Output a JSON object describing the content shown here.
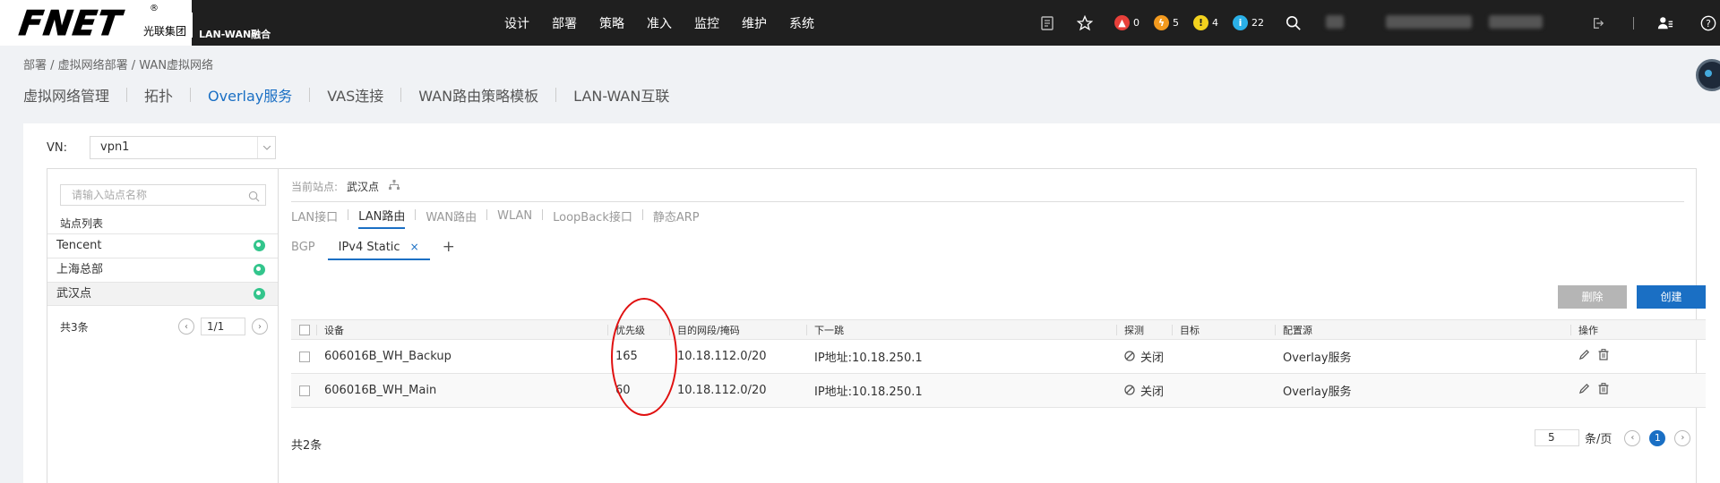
{
  "header": {
    "logo_text": "FNET",
    "logo_registered": "®",
    "logo_company": "光联集团",
    "logo_product": "LAN-WAN融合",
    "nav": [
      "设计",
      "部署",
      "策略",
      "准入",
      "监控",
      "维护",
      "系统"
    ],
    "alerts": [
      {
        "name": "critical",
        "count": "0",
        "color": "#e8403a",
        "glyph": "🔥"
      },
      {
        "name": "major",
        "count": "5",
        "color": "#f39a1e",
        "glyph": "⚡"
      },
      {
        "name": "minor",
        "count": "4",
        "color": "#f3d21e",
        "glyph": "!"
      },
      {
        "name": "info",
        "count": "22",
        "color": "#2ab0e8",
        "glyph": "i"
      }
    ]
  },
  "breadcrumb": "部署 / 虚拟网络部署 / WAN虚拟网络",
  "page_tabs": [
    "虚拟网络管理",
    "拓扑",
    "Overlay服务",
    "VAS连接",
    "WAN路由策略模板",
    "LAN-WAN互联"
  ],
  "vn": {
    "label": "VN:",
    "value": "vpn1"
  },
  "site_panel": {
    "search_placeholder": "请输入站点名称",
    "title": "站点列表",
    "sites": [
      "Tencent",
      "上海总部",
      "武汉点"
    ],
    "total": "共3条",
    "page": "1/1"
  },
  "current_site": {
    "label": "当前站点:",
    "value": "武汉点"
  },
  "sub_tabs": [
    "LAN接口",
    "LAN路由",
    "WAN路由",
    "WLAN",
    "LoopBack接口",
    "静态ARP"
  ],
  "proto_tabs": {
    "inactive": "BGP",
    "active": "IPv4 Static",
    "close": "×",
    "add": "+"
  },
  "buttons": {
    "delete": "删除",
    "create": "创建"
  },
  "table": {
    "headers": [
      "设备",
      "优先级",
      "目的网段/掩码",
      "下一跳",
      "探测",
      "目标",
      "配置源",
      "操作"
    ],
    "rows": [
      {
        "device": "606016B_WH_Backup",
        "priority": "165",
        "dest": "10.18.112.0/20",
        "nexthop": "IP地址:10.18.250.1",
        "probe": "关闭",
        "target": "",
        "source": "Overlay服务"
      },
      {
        "device": "606016B_WH_Main",
        "priority": "60",
        "dest": "10.18.112.0/20",
        "nexthop": "IP地址:10.18.250.1",
        "probe": "关闭",
        "target": "",
        "source": "Overlay服务"
      }
    ]
  },
  "pagination": {
    "total": "共2条",
    "page_size": "5",
    "per_page_label": "条/页",
    "current": "1"
  }
}
